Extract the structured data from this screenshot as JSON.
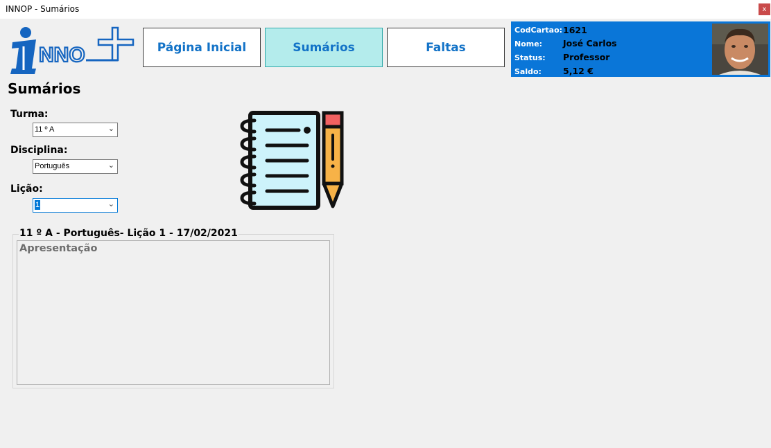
{
  "window": {
    "title": "INNOP - Sumários",
    "close_label": "x"
  },
  "logo": {
    "text": "INNO"
  },
  "nav": {
    "home_label": "Página Inicial",
    "sumarios_label": "Sumários",
    "faltas_label": "Faltas"
  },
  "user": {
    "codcartao_label": "CodCartao:",
    "codcartao": "1621",
    "nome_label": "Nome:",
    "nome": "José Carlos",
    "status_label": "Status:",
    "status": "Professor",
    "saldo_label": "Saldo:",
    "saldo": "5,12 €"
  },
  "page": {
    "title": "Sumários"
  },
  "form": {
    "turma_label": "Turma:",
    "turma_value": "11 º A",
    "disciplina_label": "Disciplina:",
    "disciplina_value": "Português",
    "licao_label": "Lição:",
    "licao_value": "1"
  },
  "summary": {
    "header": "11 º A - Português- Lição 1 - 17/02/2021",
    "text": "Apresentação"
  },
  "colors": {
    "accent": "#1272c7",
    "user_panel": "#0a76d8",
    "active_tab": "#b4ecec"
  }
}
